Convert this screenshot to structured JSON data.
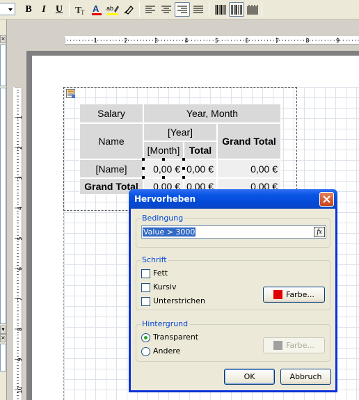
{
  "toolbar": {
    "buttons": [
      {
        "name": "bold-button",
        "label": "B"
      },
      {
        "name": "italic-button",
        "label": "I"
      },
      {
        "name": "underline-button",
        "label": "U"
      }
    ],
    "icons": [
      "text-style-icon",
      "font-color-icon",
      "highlight-color-icon",
      "clear-format-icon",
      "align-left-icon",
      "align-center-icon",
      "align-right-icon",
      "justify-icon",
      "barcode-icon",
      "barcode-2-icon",
      "barcode-3-icon"
    ]
  },
  "ruler": {
    "h_numbers": [
      "1",
      "2",
      "3",
      "4",
      "5",
      "6",
      "7",
      "8",
      "9"
    ],
    "v_numbers": [
      "1",
      "2",
      "3",
      "4",
      "5",
      "6",
      "7",
      "8",
      "9",
      "10"
    ]
  },
  "crosstab": {
    "corner": "Salary",
    "column_header": "Year, Month",
    "row_header": "Name",
    "year": "[Year]",
    "month": "[Month]",
    "total": "Total",
    "grand_total_col": "Grand Total",
    "name_field": "[Name]",
    "grand_total_row": "Grand Total",
    "values_row1": [
      "0,00 €",
      "0,00 €",
      "0,00 €"
    ],
    "values_row2": [
      "0,00 €",
      "0,00 €",
      "0,00 €"
    ]
  },
  "dialog": {
    "title": "Hervorheben",
    "bedingung_label": "Bedingung",
    "condition_value": "Value > 3000",
    "fx_label": "fx",
    "schrift_label": "Schrift",
    "fett_label": "Fett",
    "kursiv_label": "Kursiv",
    "unterstrichen_label": "Unterstrichen",
    "font_color_button": "Farbe...",
    "font_color": "#e00000",
    "hintergrund_label": "Hintergrund",
    "transparent_label": "Transparent",
    "andere_label": "Andere",
    "bg_color_button": "Farbe...",
    "bg_color": "#a0a0a0",
    "ok_label": "OK",
    "cancel_label": "Abbruch"
  }
}
